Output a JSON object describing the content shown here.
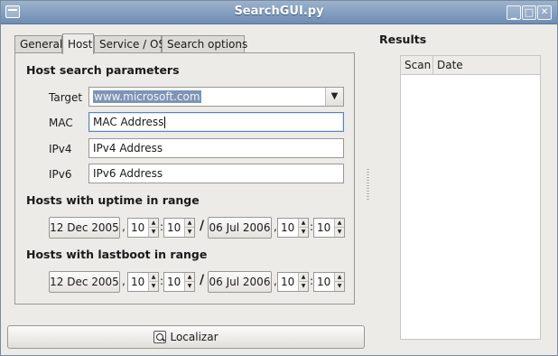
{
  "window": {
    "title": "SearchGUI.py"
  },
  "tabs": [
    {
      "label": "General"
    },
    {
      "label": "Host"
    },
    {
      "label": "Service / OS"
    },
    {
      "label": "Search options"
    }
  ],
  "host_params": {
    "section_title": "Host search parameters",
    "target": {
      "label": "Target",
      "value": "www.microsoft.com"
    },
    "mac": {
      "label": "MAC",
      "value": "MAC Address"
    },
    "ipv4": {
      "label": "IPv4",
      "value": "IPv4 Address"
    },
    "ipv6": {
      "label": "IPv6",
      "value": "IPv6 Address"
    }
  },
  "uptime": {
    "section_title": "Hosts with uptime in range",
    "from": {
      "date": "12 Dec 2005",
      "hour": "10",
      "minute": "10"
    },
    "to": {
      "date": "06 Jul 2006",
      "hour": "10",
      "minute": "10"
    }
  },
  "lastboot": {
    "section_title": "Hosts with lastboot in range",
    "from": {
      "date": "12 Dec 2005",
      "hour": "10",
      "minute": "10"
    },
    "to": {
      "date": "06 Jul 2006",
      "hour": "10",
      "minute": "10"
    }
  },
  "separators": {
    "comma": ",",
    "colon": ":",
    "slash": "/"
  },
  "search_button": {
    "label": "Localizar",
    "icon": "search-icon"
  },
  "results": {
    "title": "Results",
    "columns": [
      "Scan",
      "Date"
    ]
  },
  "window_controls": {
    "minimize": "_",
    "maximize": "□",
    "close": "✕"
  }
}
